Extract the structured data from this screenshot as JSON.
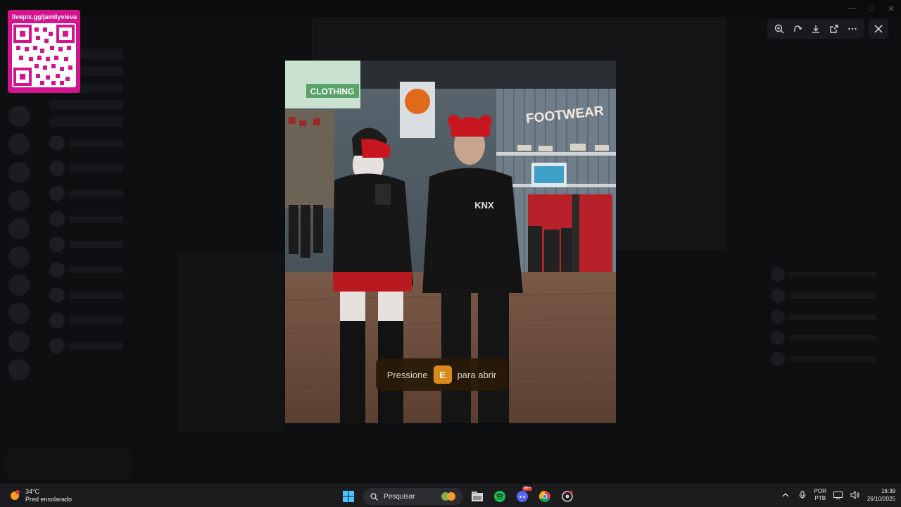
{
  "qr": {
    "url": "livepix.gg/jamilyvieva"
  },
  "viewer": {
    "toolbar": [
      "zoom-in-icon",
      "rotate-icon",
      "download-icon",
      "open-external-icon",
      "more-icon"
    ],
    "close_icon": "close-icon"
  },
  "game": {
    "prompt_before": "Pressione",
    "prompt_key": "E",
    "prompt_after": "para abrir",
    "store_sign_footwear": "FOOTWEAR",
    "store_sign_clothing": "CLOTHING"
  },
  "taskbar": {
    "weather_temp": "34°C",
    "weather_desc": "Pred ensolarado",
    "search_placeholder": "Pesquisar",
    "lang_top": "POR",
    "lang_bottom": "PTB",
    "time": "16:39",
    "date": "26/10/2025",
    "apps": [
      "file-explorer-icon",
      "spotify-icon",
      "discord-icon",
      "chrome-icon",
      "game-launcher-icon"
    ],
    "discord_badge": "99+"
  },
  "colors": {
    "accent_pink": "#d4148f",
    "prompt_key": "#d98a1c",
    "taskbar": "#1c1c1f"
  }
}
